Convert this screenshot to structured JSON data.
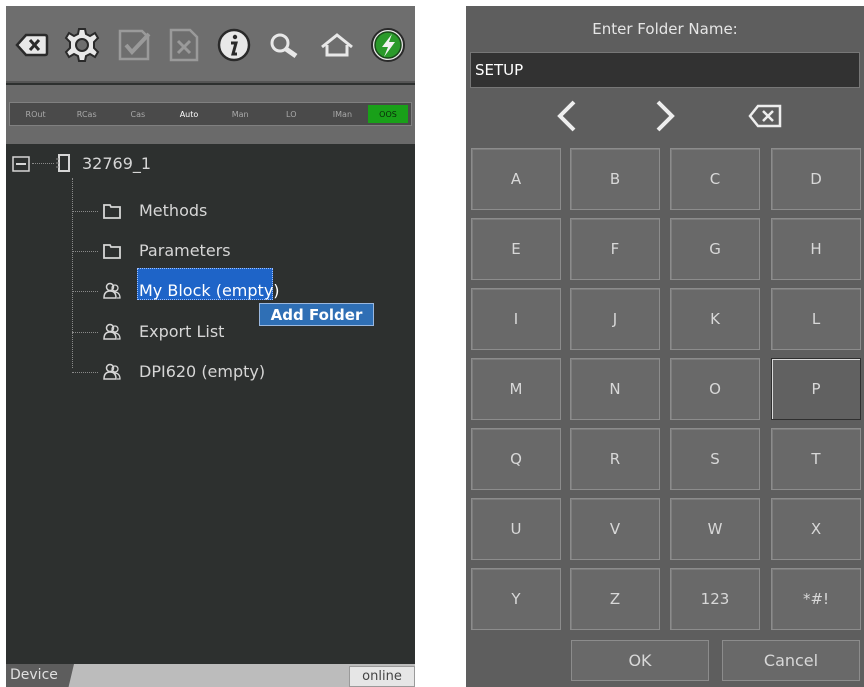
{
  "toolbar": {
    "icons": [
      "backspace-icon",
      "gear-icon",
      "checklist-icon",
      "cancel-doc-icon",
      "info-icon",
      "search-icon",
      "home-icon",
      "power-icon"
    ]
  },
  "modes": [
    {
      "label": "ROut",
      "active": false
    },
    {
      "label": "RCas",
      "active": false
    },
    {
      "label": "Cas",
      "active": false
    },
    {
      "label": "Auto",
      "active": true
    },
    {
      "label": "Man",
      "active": false
    },
    {
      "label": "LO",
      "active": false
    },
    {
      "label": "IMan",
      "active": false
    },
    {
      "label": "OOS",
      "active": true,
      "color": "#19a019"
    }
  ],
  "tree": {
    "root": "32769_1",
    "items": [
      {
        "label": "Methods",
        "icon": "folder-icon"
      },
      {
        "label": "Parameters",
        "icon": "folder-icon"
      },
      {
        "label": "My Block (empty)",
        "icon": "users-icon",
        "selected": true
      },
      {
        "label": "Export List",
        "icon": "users-icon"
      },
      {
        "label": "DPI620 (empty)",
        "icon": "users-icon"
      }
    ]
  },
  "context_menu": {
    "item": "Add Folder"
  },
  "status": {
    "tab": "Device",
    "connection": "online"
  },
  "keyboard": {
    "prompt": "Enter Folder Name:",
    "value": "SETUP",
    "keys": [
      "A",
      "B",
      "C",
      "D",
      "E",
      "F",
      "G",
      "H",
      "I",
      "J",
      "K",
      "L",
      "M",
      "N",
      "O",
      "P",
      "Q",
      "R",
      "S",
      "T",
      "U",
      "V",
      "W",
      "X",
      "Y",
      "Z",
      "123",
      "*#!"
    ],
    "ok": "OK",
    "cancel": "Cancel"
  },
  "colors": {
    "selection": "#1e64c8",
    "context_menu": "#2f6fb5",
    "oos": "#19a019"
  }
}
